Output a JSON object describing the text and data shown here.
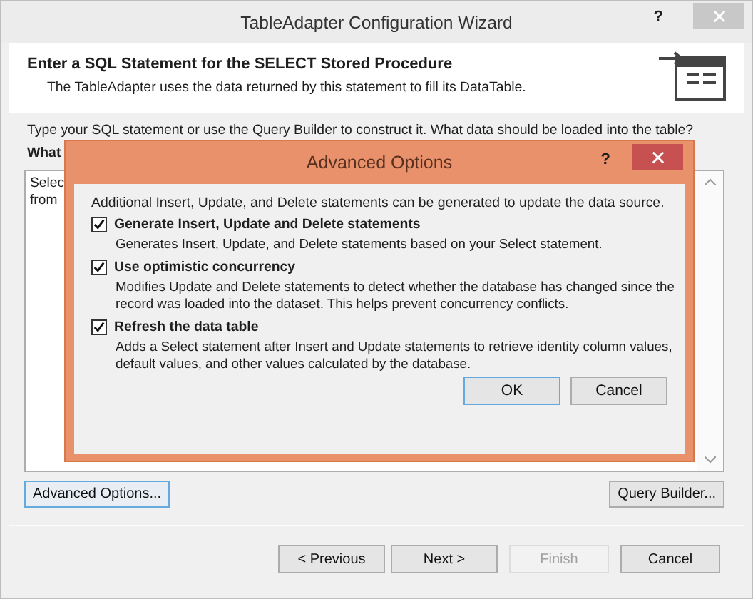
{
  "window": {
    "title": "TableAdapter Configuration Wizard",
    "help": "?"
  },
  "header": {
    "title": "Enter a SQL Statement for the SELECT Stored Procedure",
    "subtitle": "The TableAdapter uses the data returned by this statement to fill its DataTable."
  },
  "body": {
    "instructions": "Type your SQL statement or use the Query Builder to construct it. What data should be loaded into the table?",
    "prompt": "What",
    "sql_lines": [
      "Selec",
      "from"
    ]
  },
  "dialog": {
    "title": "Advanced Options",
    "help": "?",
    "intro": "Additional  Insert, Update, and Delete statements can be generated to update the data source.",
    "options": [
      {
        "label": "Generate Insert, Update and Delete statements",
        "checked": true,
        "description": "Generates Insert, Update, and Delete statements based on your Select statement."
      },
      {
        "label": "Use optimistic concurrency",
        "checked": true,
        "description": "Modifies Update and Delete statements to detect whether the database has changed since the record was loaded into the dataset. This helps prevent concurrency conflicts."
      },
      {
        "label": "Refresh the data table",
        "checked": true,
        "description": "Adds a Select statement after Insert and Update statements to retrieve identity column values, default values, and other values calculated by the database."
      }
    ],
    "buttons": [
      {
        "label": "OK",
        "focused": true
      },
      {
        "label": "Cancel",
        "focused": false
      }
    ]
  },
  "tool_buttons": [
    {
      "label": "Advanced Options...",
      "focused": true
    },
    {
      "label": "Query Builder...",
      "focused": false
    }
  ],
  "nav_buttons": [
    {
      "label": "< Previous",
      "disabled": false
    },
    {
      "label": "Next >",
      "disabled": false
    },
    {
      "label": "Finish",
      "disabled": true
    },
    {
      "label": "Cancel",
      "disabled": false
    }
  ]
}
